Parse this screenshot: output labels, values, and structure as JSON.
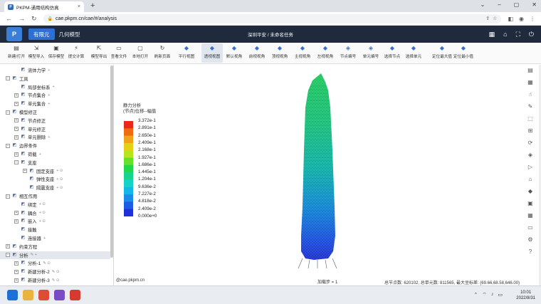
{
  "browser": {
    "tab_title": "PKPM-通用结构仿真",
    "tab_close": "×",
    "new_tab": "+",
    "url": "cae.pkpm.cn/cae/#/analysis"
  },
  "app": {
    "logo_text": "P",
    "tab_fem": "有限元",
    "tab_geom": "几何模型",
    "project_title": "深圳平安 / 未命名任务",
    "accent_color": "#2f6fd1",
    "header_color": "#1f2a3c"
  },
  "toolbar": [
    {
      "label": "新建/打开",
      "icon": "open-icon"
    },
    {
      "label": "模型导入",
      "icon": "import-icon"
    },
    {
      "label": "保存模型",
      "icon": "save-icon"
    },
    {
      "label": "提交计算",
      "icon": "compute-icon"
    },
    {
      "label": "模型导出",
      "icon": "export-icon"
    },
    {
      "label": "查看文件",
      "icon": "file-icon"
    },
    {
      "label": "本地打开",
      "icon": "monitor-icon"
    },
    {
      "label": "刷新页面",
      "icon": "refresh-icon"
    },
    {
      "label": "平行视图",
      "icon": "cube-icon"
    },
    {
      "label": "透视视图",
      "icon": "cube-icon"
    },
    {
      "label": "默认视角",
      "icon": "cube-icon"
    },
    {
      "label": "前视视角",
      "icon": "cube-icon"
    },
    {
      "label": "顶视视角",
      "icon": "cube-icon"
    },
    {
      "label": "主视视角",
      "icon": "cube-icon"
    },
    {
      "label": "左视视角",
      "icon": "cube-icon"
    },
    {
      "label": "节点编号",
      "icon": "tag-icon"
    },
    {
      "label": "单元编号",
      "icon": "tag-icon"
    },
    {
      "label": "选择节点",
      "icon": "cube-icon"
    },
    {
      "label": "选择单元",
      "icon": "cube-icon"
    },
    {
      "label": "定位最大值",
      "icon": "cube-icon"
    },
    {
      "label": "定位最小值",
      "icon": "cube-icon"
    }
  ],
  "tree": [
    {
      "level": 1,
      "label": "流体力学",
      "tail": "+",
      "icon": "fluid-icon",
      "exp": ""
    },
    {
      "level": 0,
      "label": "工具",
      "tail": "",
      "icon": "tool-icon",
      "exp": "−"
    },
    {
      "level": 1,
      "label": "局部坐标系",
      "tail": "+",
      "icon": "axes-icon",
      "exp": ""
    },
    {
      "level": 1,
      "label": "节点集合",
      "tail": "+",
      "icon": "node-set-icon",
      "exp": "+"
    },
    {
      "level": 1,
      "label": "单元集合",
      "tail": "+",
      "icon": "element-set-icon",
      "exp": "+"
    },
    {
      "level": 0,
      "label": "模型修正",
      "tail": "",
      "icon": "model-icon",
      "exp": "−"
    },
    {
      "level": 1,
      "label": "节点修正",
      "tail": "",
      "icon": "node-icon",
      "exp": "+"
    },
    {
      "level": 1,
      "label": "单元修正",
      "tail": "",
      "icon": "element-icon",
      "exp": "+"
    },
    {
      "level": 1,
      "label": "单元删除",
      "tail": "+",
      "icon": "delete-icon",
      "exp": "+"
    },
    {
      "level": 0,
      "label": "边界条件",
      "tail": "",
      "icon": "boundary-icon",
      "exp": "−"
    },
    {
      "level": 1,
      "label": "荷载",
      "tail": "+",
      "icon": "load-icon",
      "exp": "+"
    },
    {
      "level": 1,
      "label": "支座",
      "tail": "",
      "icon": "support-icon",
      "exp": "−"
    },
    {
      "level": 2,
      "label": "固定支座",
      "tail": "+ ⊙",
      "icon": "fixed-icon",
      "exp": "+"
    },
    {
      "level": 2,
      "label": "弹性支座",
      "tail": "+ ⊙",
      "icon": "elastic-icon",
      "exp": ""
    },
    {
      "level": 2,
      "label": "隔震支座",
      "tail": "+ ⊙",
      "icon": "isolator-icon",
      "exp": ""
    },
    {
      "level": 0,
      "label": "相互作用",
      "tail": "",
      "icon": "interaction-icon",
      "exp": "−"
    },
    {
      "level": 1,
      "label": "绑定",
      "tail": "+ ⊙",
      "icon": "tie-icon",
      "exp": ""
    },
    {
      "level": 1,
      "label": "耦合",
      "tail": "+ ⊙",
      "icon": "couple-icon",
      "exp": "+"
    },
    {
      "level": 1,
      "label": "嵌入",
      "tail": "+ ⊙",
      "icon": "embed-icon",
      "exp": "+"
    },
    {
      "level": 1,
      "label": "接触",
      "tail": "",
      "icon": "contact-icon",
      "exp": ""
    },
    {
      "level": 1,
      "label": "连接器",
      "tail": "+",
      "icon": "connector-icon",
      "exp": ""
    },
    {
      "level": 0,
      "label": "约束方程",
      "tail": "",
      "icon": "equation-icon",
      "exp": "+"
    },
    {
      "level": 0,
      "label": "分析",
      "tail": "✎ +",
      "icon": "analysis-icon",
      "exp": "−",
      "highlight": true
    },
    {
      "level": 1,
      "label": "分析-1",
      "tail": "✎ ⊙",
      "icon": "step-icon",
      "exp": "+"
    },
    {
      "level": 1,
      "label": "新建分析-2",
      "tail": "✎ ⊙",
      "icon": "step-icon",
      "exp": "+"
    },
    {
      "level": 1,
      "label": "新建分析-3",
      "tail": "✎ ⊙",
      "icon": "step-icon",
      "exp": "+"
    }
  ],
  "legend": {
    "title_line1": "静力分析",
    "title_line2": "(节点)位移--幅值",
    "values": [
      "3.372e-1",
      "2.891e-1",
      "2.650e-1",
      "2.409e-1",
      "2.168e-1",
      "1.927e-1",
      "1.686e-1",
      "1.445e-1",
      "1.204e-1",
      "9.636e-2",
      "7.227e-2",
      "4.818e-2",
      "2.409e-2",
      "0.000e+0"
    ],
    "colors": [
      "#e8281a",
      "#f06a10",
      "#f0a21a",
      "#e6d015",
      "#b8e41c",
      "#68e02a",
      "#22d84a",
      "#17d58e",
      "#14d4c8",
      "#14b8e6",
      "#1b8cea",
      "#1d5ce4",
      "#1f30d8"
    ]
  },
  "viewport": {
    "watermark": "@cae.pkpm.cn",
    "load_step": "加载步 = 1",
    "status": "总节点数: 620102, 总单元数: 811565, 最大坐标差: (69.66,68.58,646.00)"
  },
  "right_tools": [
    "layers-icon",
    "tree-icon",
    "pointer-icon",
    "ruler-icon",
    "frame-icon",
    "axis-icon",
    "rotate-icon",
    "tag-icon",
    "send-icon",
    "clip-icon",
    "cube-icon",
    "box-icon",
    "grid-icon",
    "display-icon",
    "settings-icon",
    "help-icon"
  ],
  "taskbar": {
    "time": "10:01",
    "date": "2022/8/31",
    "apps": [
      {
        "name": "windows-start",
        "color": "#1f6fd8"
      },
      {
        "name": "file-explorer",
        "color": "#e9b33c"
      },
      {
        "name": "chrome",
        "color": "#dd4b39"
      },
      {
        "name": "visual-studio",
        "color": "#7a4bc4"
      },
      {
        "name": "wps",
        "color": "#d43a2f"
      }
    ]
  }
}
